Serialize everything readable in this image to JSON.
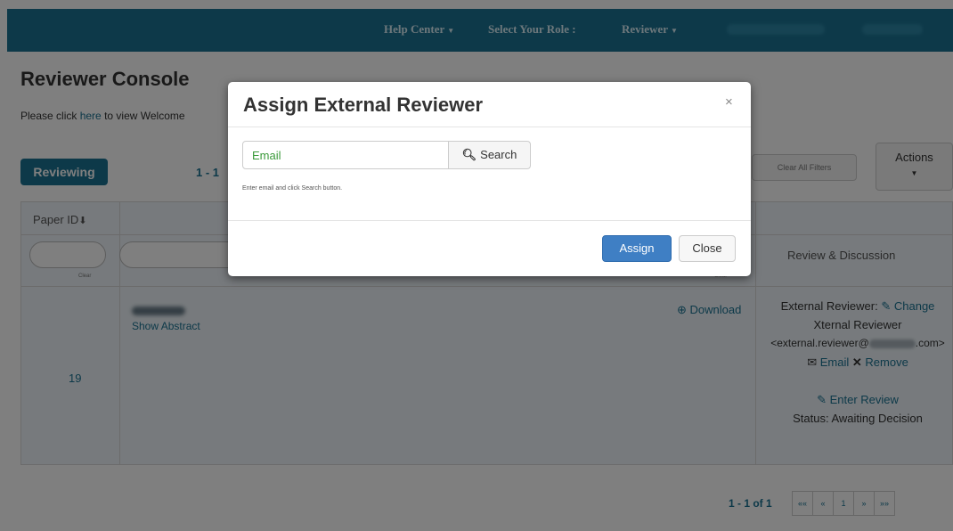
{
  "navbar": {
    "help_center": "Help Center",
    "select_role_label": "Select Your Role :",
    "role_value": "Reviewer"
  },
  "page": {
    "title": "Reviewer Console",
    "welcome_prefix": "Please click ",
    "welcome_link": "here",
    "welcome_suffix": " to view Welcome"
  },
  "tabs": {
    "reviewing": "Reviewing"
  },
  "pager_top": "1 - 1",
  "toolbar": {
    "clear_filters": "Clear All Filters",
    "actions": "Actions"
  },
  "table": {
    "headers": {
      "paper_id": "Paper ID",
      "review": "Review & Discussion"
    },
    "clear_label": "Clear",
    "row": {
      "paper_id": "19",
      "show_abstract": "Show Abstract",
      "download": "Download",
      "review": {
        "external_reviewer_label": "External Reviewer:",
        "change_link": "Change",
        "reviewer_name": "Xternal Reviewer",
        "email_prefix": "<external.reviewer@",
        "email_suffix": ".com>",
        "email_link": "Email",
        "remove_link": "Remove",
        "enter_review_link": "Enter Review",
        "status": "Status: Awaiting Decision"
      }
    }
  },
  "pager_bottom": {
    "summary": "1 - 1 of 1",
    "buttons": [
      "««",
      "«",
      "1",
      "»",
      "»»"
    ]
  },
  "modal": {
    "title": "Assign External Reviewer",
    "close_x": "×",
    "email_placeholder": "Email",
    "search_label": "Search",
    "help_text": "Enter email and click Search button.",
    "assign_label": "Assign",
    "close_label": "Close"
  },
  "icons": {
    "search": "magnifier-icon",
    "download": "download-icon",
    "edit": "edit-icon",
    "envelope": "envelope-icon",
    "remove": "x-icon",
    "sort": "sort-down-arrow-icon"
  },
  "colors": {
    "brand": "#1b7393",
    "primary_button": "#3f7fc4",
    "placeholder": "#3a9a3a"
  }
}
